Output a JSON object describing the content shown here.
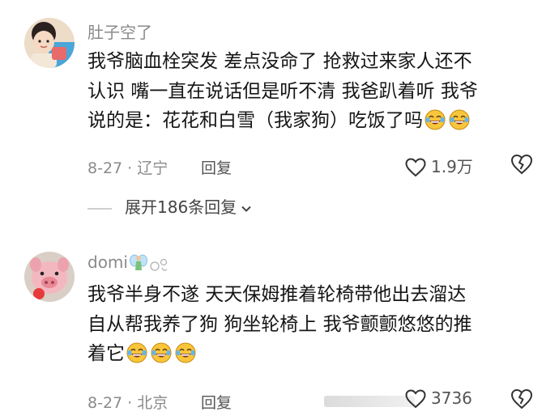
{
  "comments": [
    {
      "username": "肚子空了",
      "lines": [
        "我爷脑血栓突发 差点没命了 抢救过来家人还不",
        "认识 嘴一直在说话但是听不清 我爸趴着听 我爷",
        "说的是：花花和白雪（我家狗）吃饭了吗"
      ],
      "date": "8-27",
      "location": "辽宁",
      "reply_label": "回复",
      "likes": "1.9万",
      "expand_label": "展开186条回复"
    },
    {
      "username": "domi",
      "lines": [
        "我爷半身不遂 天天保姆推着轮椅带他出去溜达",
        "自从帮我养了狗 狗坐轮椅上 我爷颤颤悠悠的推",
        "着它"
      ],
      "date": "8-27",
      "location": "北京",
      "reply_label": "回复",
      "likes": "3736"
    }
  ],
  "icons": [
    "avatar-girl",
    "avatar-pig",
    "fairy-icon",
    "heart-icon",
    "broken-heart-icon",
    "chevron-down-icon",
    "laughing-tears-emoji"
  ],
  "colors": {
    "text": "#161616",
    "muted": "#8a8a8a",
    "emoji_face": "#f9c63b"
  }
}
